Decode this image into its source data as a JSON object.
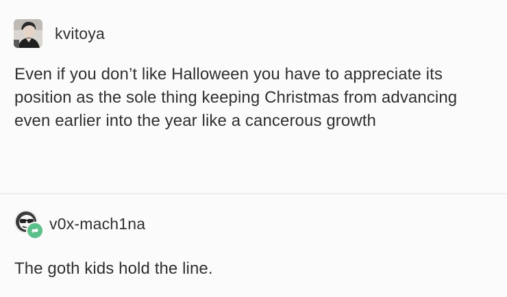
{
  "posts": [
    {
      "username": "kvitoya",
      "avatar_icon": "user-avatar-photo",
      "text": "Even if you don’t like Halloween you have to appreciate its position as the sole thing keeping Christmas from advancing even earlier into the year like a cancerous growth"
    },
    {
      "username": "v0x-mach1na",
      "avatar_icon": "user-avatar-sunglasses",
      "badge_icon": "reblog-icon",
      "text": "The goth kids hold the line."
    }
  ],
  "colors": {
    "reblog_badge": "#5cc08a",
    "text": "#2f2f2f",
    "background": "#fbfbfb"
  }
}
